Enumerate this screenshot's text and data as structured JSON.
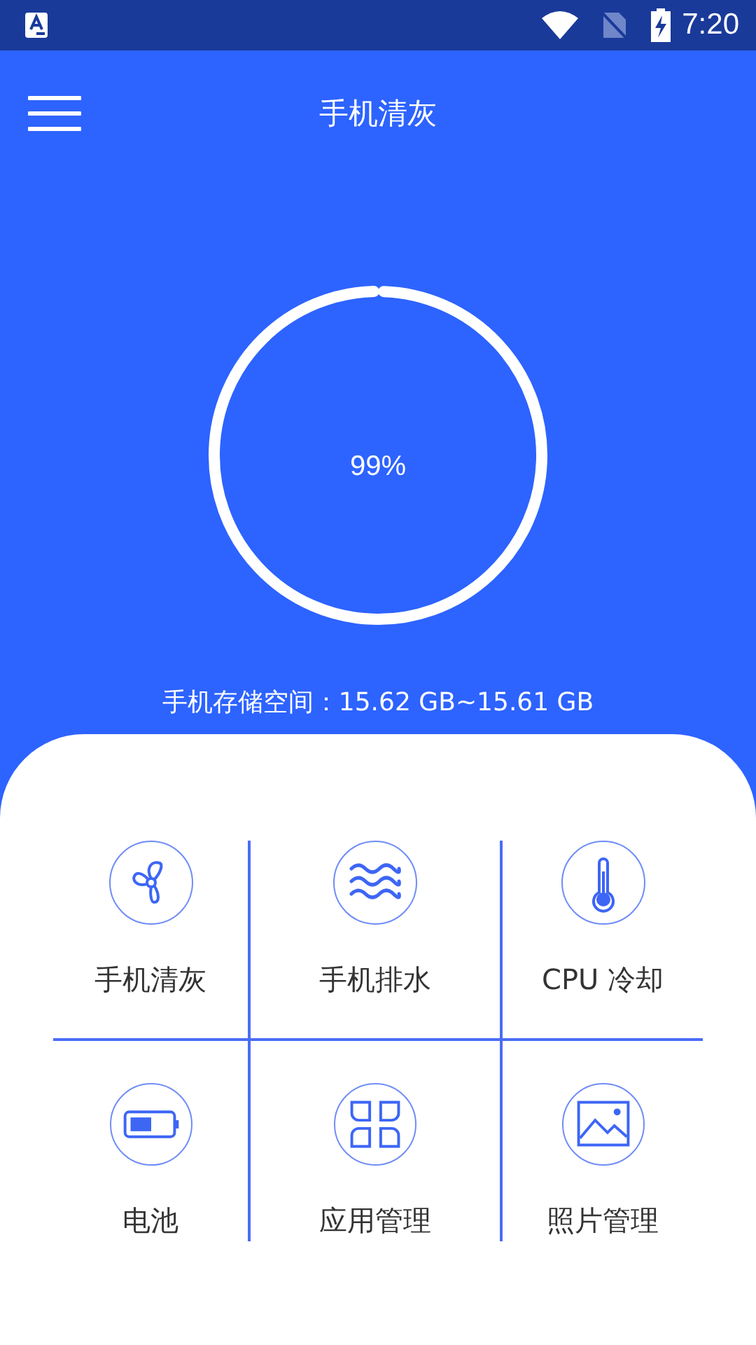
{
  "status_bar": {
    "time": "7:20"
  },
  "app_bar": {
    "title": "手机清灰"
  },
  "storage_ring": {
    "level": 0.99,
    "percent": "99%"
  },
  "storage_text": "手机存储空间：15.62 GB~15.61 GB",
  "tools": [
    {
      "kind": "fan",
      "label": "手机清灰"
    },
    {
      "kind": "waves",
      "label": "手机排水"
    },
    {
      "kind": "thermometer",
      "label": "CPU 冷却"
    },
    {
      "kind": "battery",
      "label": "电池"
    },
    {
      "kind": "apps",
      "label": "应用管理"
    },
    {
      "kind": "image",
      "label": "照片管理"
    }
  ]
}
